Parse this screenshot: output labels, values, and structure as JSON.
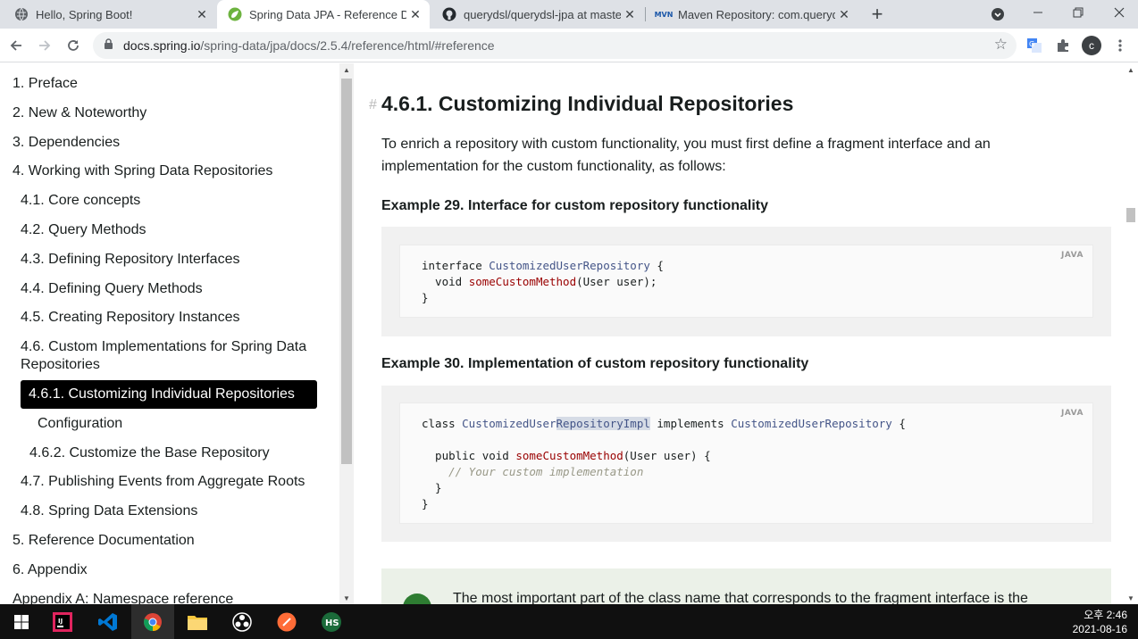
{
  "browser": {
    "tabs": [
      {
        "title": "Hello, Spring Boot!",
        "icon": "globe-icon",
        "active": false
      },
      {
        "title": "Spring Data JPA - Reference Do",
        "icon": "spring-leaf-icon",
        "active": true
      },
      {
        "title": "querydsl/querydsl-jpa at master",
        "icon": "github-icon",
        "active": false
      },
      {
        "title": "Maven Repository: com.queryds",
        "icon": "mvn-icon",
        "active": false
      }
    ],
    "new_tab": "+",
    "url_host": "docs.spring.io",
    "url_rest": "/spring-data/jpa/docs/2.5.4/reference/html/#reference",
    "profile_initial": "c"
  },
  "sidebar": {
    "items": [
      "1. Preface",
      "2. New & Noteworthy",
      "3. Dependencies",
      "4. Working with Spring Data Repositories",
      "4.1. Core concepts",
      "4.2. Query Methods",
      "4.3. Defining Repository Interfaces",
      "4.4. Defining Query Methods",
      "4.5. Creating Repository Instances",
      "4.6. Custom Implementations for Spring Data",
      "Repositories",
      "4.6.1. Customizing Individual Repositories",
      "Configuration",
      "4.6.2. Customize the Base Repository",
      "4.7. Publishing Events from Aggregate Roots",
      "4.8. Spring Data Extensions",
      "5. Reference Documentation",
      "6. Appendix",
      "Appendix A: Namespace reference"
    ]
  },
  "main": {
    "hash": "#",
    "heading": "4.6.1. Customizing Individual Repositories",
    "intro_line1": "To enrich a repository with custom functionality, you must first define a fragment interface and an",
    "intro_line2": "implementation for the custom functionality, as follows:",
    "example1_title": "Example 29. Interface for custom repository functionality",
    "example2_title": "Example 30. Implementation of custom repository functionality",
    "lang_label": "JAVA",
    "code1": {
      "l1_kw": "interface ",
      "l1_ty": "CustomizedUserRepository",
      "l1_end": " {",
      "l2_kw": "  void ",
      "l2_fn": "someCustomMethod",
      "l2_end": "(User user);",
      "l3": "}"
    },
    "code2": {
      "l1_kw": "class ",
      "l1_ty_a": "CustomizedUser",
      "l1_ty_hl": "RepositoryImpl",
      "l1_mid": " implements ",
      "l1_ty2": "CustomizedUserRepository",
      "l1_end": " {",
      "l3_kw": "  public void ",
      "l3_fn": "someCustomMethod",
      "l3_end": "(User user) {",
      "l4_cm": "    // Your custom implementation",
      "l5": "  }",
      "l6": "}"
    },
    "admonition_text": "The most important part of the class name that corresponds to the fragment interface is the"
  },
  "taskbar": {
    "apps": [
      "windows-start-icon",
      "intellij-icon",
      "vscode-icon",
      "chrome-icon",
      "file-explorer-icon",
      "obs-icon",
      "postman-icon",
      "hs-icon"
    ],
    "time": "오후 2:46",
    "date": "2021-08-16"
  }
}
